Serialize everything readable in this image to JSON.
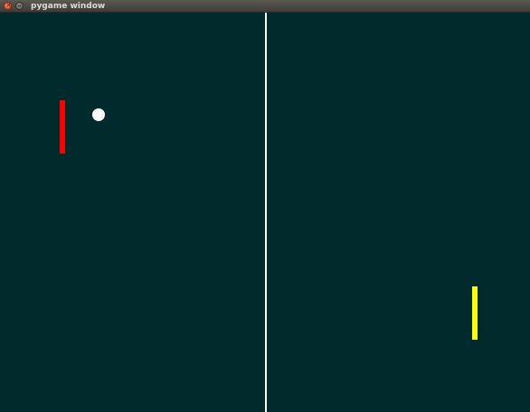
{
  "window": {
    "title": "pygame window",
    "close_icon": "close-icon",
    "minimize_icon": "minimize-icon"
  },
  "game": {
    "background_color": "#002a2b",
    "divider_color": "#ffffff",
    "left_paddle_color": "#ff0000",
    "right_paddle_color": "#ffff00",
    "ball_color": "#ffffff"
  }
}
